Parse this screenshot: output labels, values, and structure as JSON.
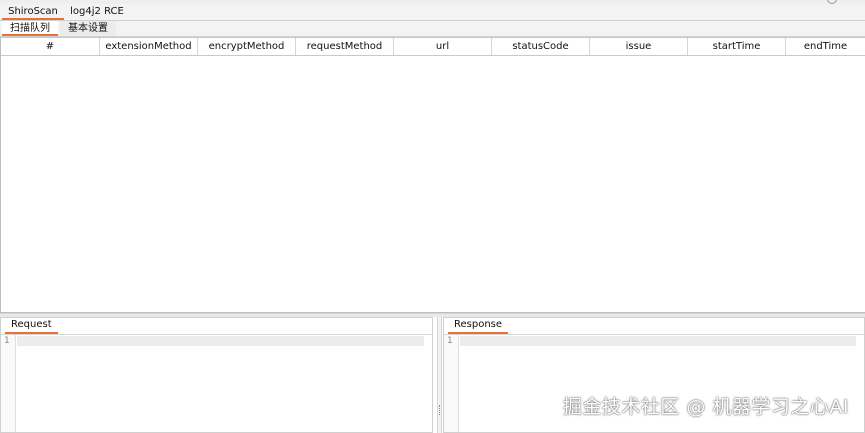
{
  "main_tabs": [
    {
      "label": "ShiroScan",
      "active": true
    },
    {
      "label": "log4j2 RCE",
      "active": false
    }
  ],
  "sub_tabs": [
    {
      "label": "扫描队列",
      "active": true
    },
    {
      "label": "基本设置",
      "active": false
    }
  ],
  "table": {
    "columns": [
      "#",
      "extensionMethod",
      "encryptMethod",
      "requestMethod",
      "url",
      "statusCode",
      "issue",
      "startTime",
      "endTime"
    ],
    "rows": []
  },
  "request_panel": {
    "tab_label": "Request",
    "line_number": "1"
  },
  "response_panel": {
    "tab_label": "Response",
    "line_number": "1"
  },
  "watermark": "掘金技术社区 @ 机器学习之心AI",
  "colors": {
    "accent": "#e8713a"
  }
}
